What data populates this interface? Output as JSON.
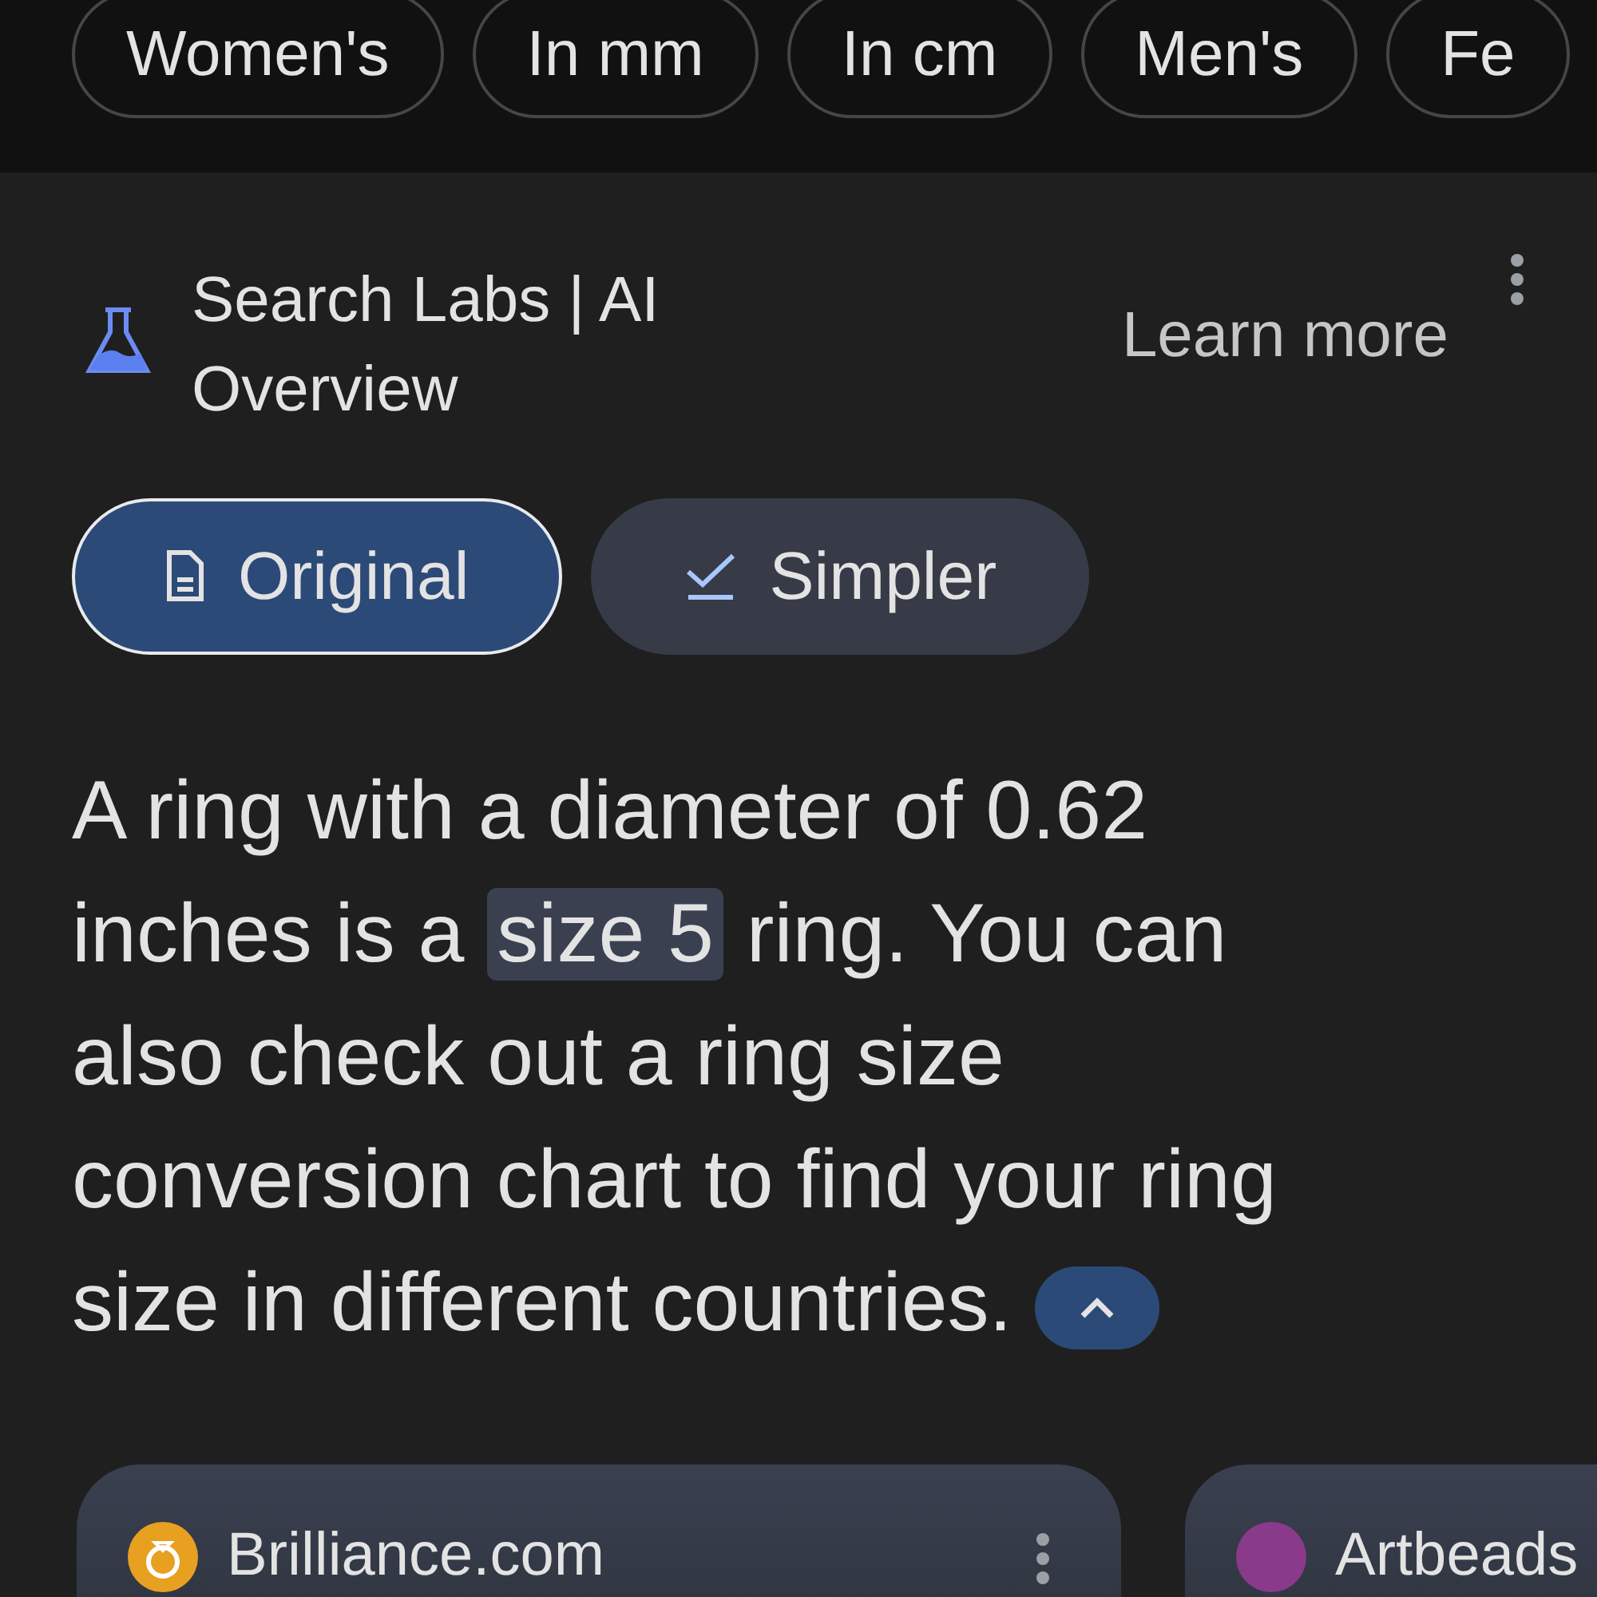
{
  "filter_chips": [
    {
      "label": "Women's"
    },
    {
      "label": "In mm"
    },
    {
      "label": "In cm"
    },
    {
      "label": "Men's"
    },
    {
      "label": "Fe"
    }
  ],
  "overview": {
    "title": "Search Labs | AI Overview",
    "learn_more": "Learn more",
    "modes": [
      {
        "label": "Original",
        "selected": true
      },
      {
        "label": "Simpler",
        "selected": false
      }
    ],
    "answer": "A ring with a diameter of 0.62 inches is a **size 5** ring. You can also check out a ring size conversion chart to find your ring size in different countries.",
    "expanded": true,
    "sources": [
      {
        "site": "Brilliance.com",
        "color": "#e8a020"
      },
      {
        "site": "Artbeads",
        "color": "#8a3a8a"
      }
    ]
  }
}
